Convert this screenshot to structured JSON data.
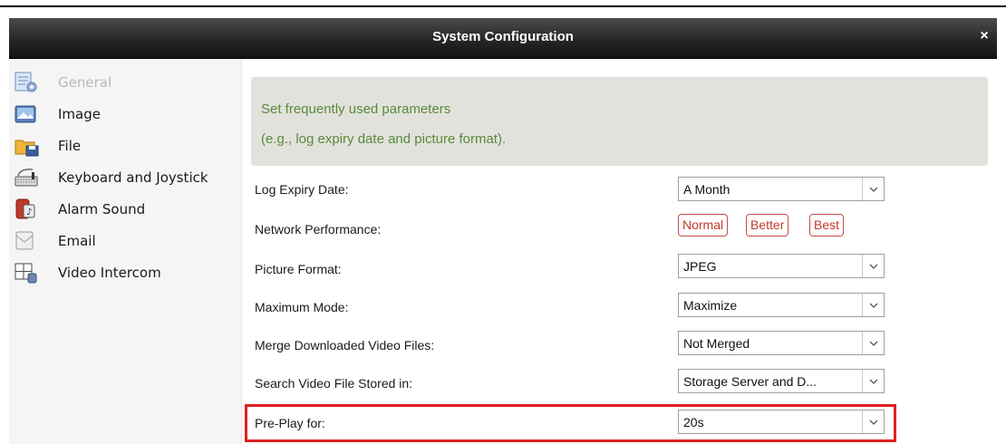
{
  "window": {
    "title": "System Configuration"
  },
  "sidebar": {
    "items": [
      {
        "label": "General",
        "icon": "general-settings-icon",
        "disabled": true
      },
      {
        "label": "Image",
        "icon": "image-icon"
      },
      {
        "label": "File",
        "icon": "folder-icon"
      },
      {
        "label": "Keyboard and Joystick",
        "icon": "keyboard-icon"
      },
      {
        "label": "Alarm Sound",
        "icon": "alarm-sound-icon"
      },
      {
        "label": "Email",
        "icon": "email-icon"
      },
      {
        "label": "Video Intercom",
        "icon": "video-intercom-icon"
      }
    ]
  },
  "description": {
    "line1": "Set frequently used parameters",
    "line2": "(e.g., log expiry date and picture format)."
  },
  "settings": {
    "log_expiry": {
      "label": "Log Expiry Date:",
      "value": "A Month"
    },
    "network_performance": {
      "label": "Network Performance:",
      "options": [
        "Normal",
        "Better",
        "Best"
      ]
    },
    "picture_format": {
      "label": "Picture Format:",
      "value": "JPEG"
    },
    "maximum_mode": {
      "label": "Maximum Mode:",
      "value": "Maximize"
    },
    "merge_downloaded": {
      "label": "Merge Downloaded Video Files:",
      "value": "Not Merged"
    },
    "search_stored_in": {
      "label": "Search Video File Stored in:",
      "value": "Storage Server and D..."
    },
    "pre_play": {
      "label": "Pre-Play for:",
      "value": "20s"
    }
  },
  "colors": {
    "accent_text": "#5a8a3a",
    "perf_button": "#c0392b",
    "highlight": "#e02020",
    "titlebar": "#262626"
  }
}
